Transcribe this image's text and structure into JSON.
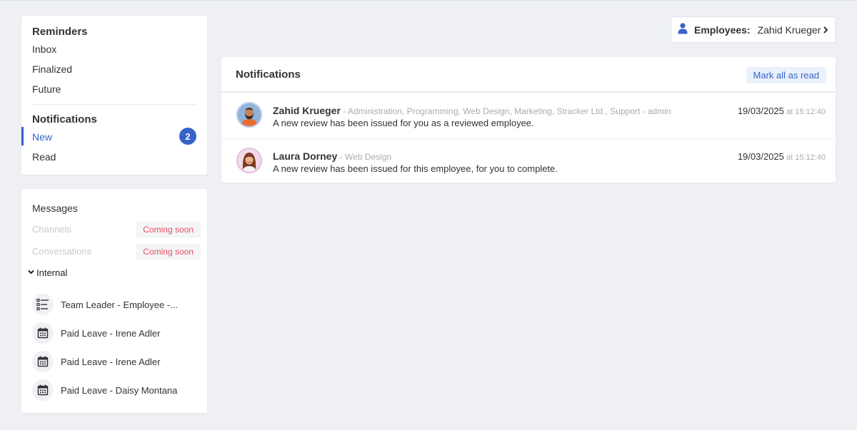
{
  "reminders": {
    "title": "Reminders",
    "items": [
      "Inbox",
      "Finalized",
      "Future"
    ]
  },
  "notifications_nav": {
    "title": "Notifications",
    "items": [
      {
        "label": "New",
        "count": "2",
        "active": true
      },
      {
        "label": "Read"
      }
    ]
  },
  "messages": {
    "title": "Messages",
    "channels": {
      "label": "Channels",
      "badge": "Coming soon"
    },
    "conversations": {
      "label": "Conversations",
      "badge": "Coming soon"
    },
    "internal": {
      "label": "Internal"
    },
    "items": [
      {
        "label": "Team Leader - Employee -...",
        "icon": "checklist-icon"
      },
      {
        "label": "Paid Leave - Irene Adler",
        "icon": "calendar-icon"
      },
      {
        "label": "Paid Leave - Irene Adler",
        "icon": "calendar-icon"
      },
      {
        "label": "Paid Leave - Daisy Montana",
        "icon": "calendar-icon"
      }
    ]
  },
  "employee_selector": {
    "label": "Employees:",
    "value": "Zahid Krueger"
  },
  "panel": {
    "title": "Notifications",
    "mark_all": "Mark all as read",
    "rows": [
      {
        "name": "Zahid Krueger",
        "meta": " - Administration, Programming, Web Design, Marketing, Stracker Ltd., Support - admin",
        "text": "A new review has been issued for you as a reviewed employee.",
        "date": "19/03/2025",
        "time": " at 15:12:40"
      },
      {
        "name": "Laura Dorney",
        "meta": " - Web Design",
        "text": "A new review has been issued for this employee, for you to complete.",
        "date": "19/03/2025",
        "time": " at 15:12:40"
      }
    ]
  },
  "colors": {
    "accent": "#3563c9",
    "coming_soon": "#ea4f5f",
    "background": "#eef0f4"
  }
}
